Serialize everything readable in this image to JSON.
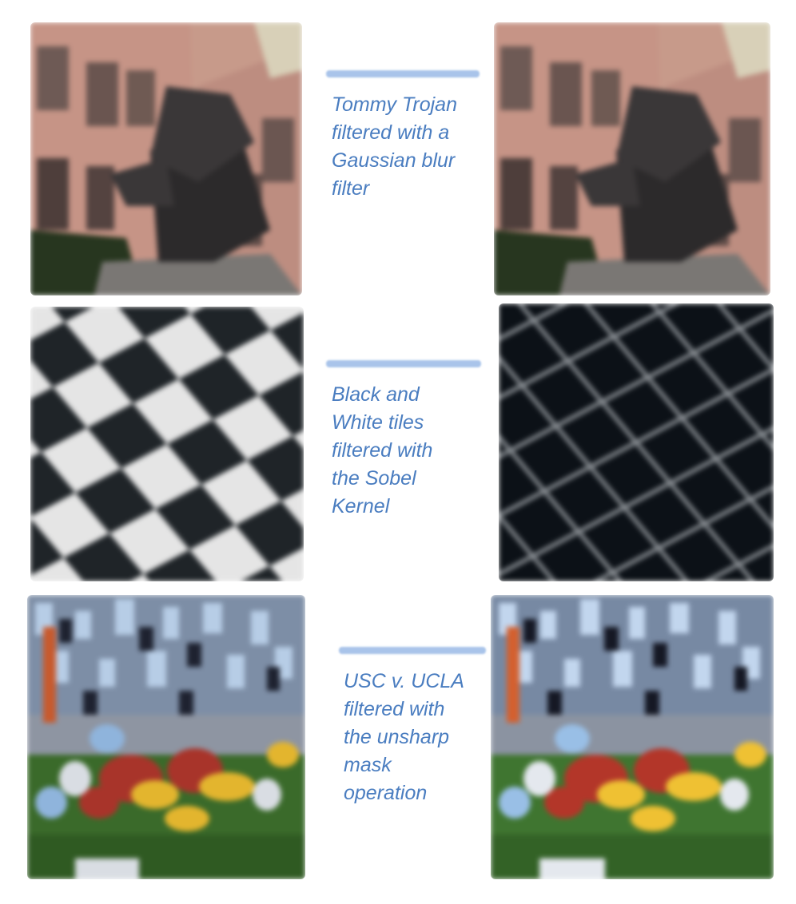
{
  "captions": {
    "gaussian": "Tommy Trojan\nfiltered with a\nGaussian blur\nfilter",
    "sobel": "Black and\nWhite tiles\nfiltered with\nthe Sobel\nKernel",
    "unsharp": "USC v. UCLA\nfiltered with\nthe unsharp\nmask\noperation"
  },
  "colors": {
    "caption_text": "#4a7dc0",
    "caption_bar": "#a9c4ea",
    "background": "#ffffff"
  }
}
